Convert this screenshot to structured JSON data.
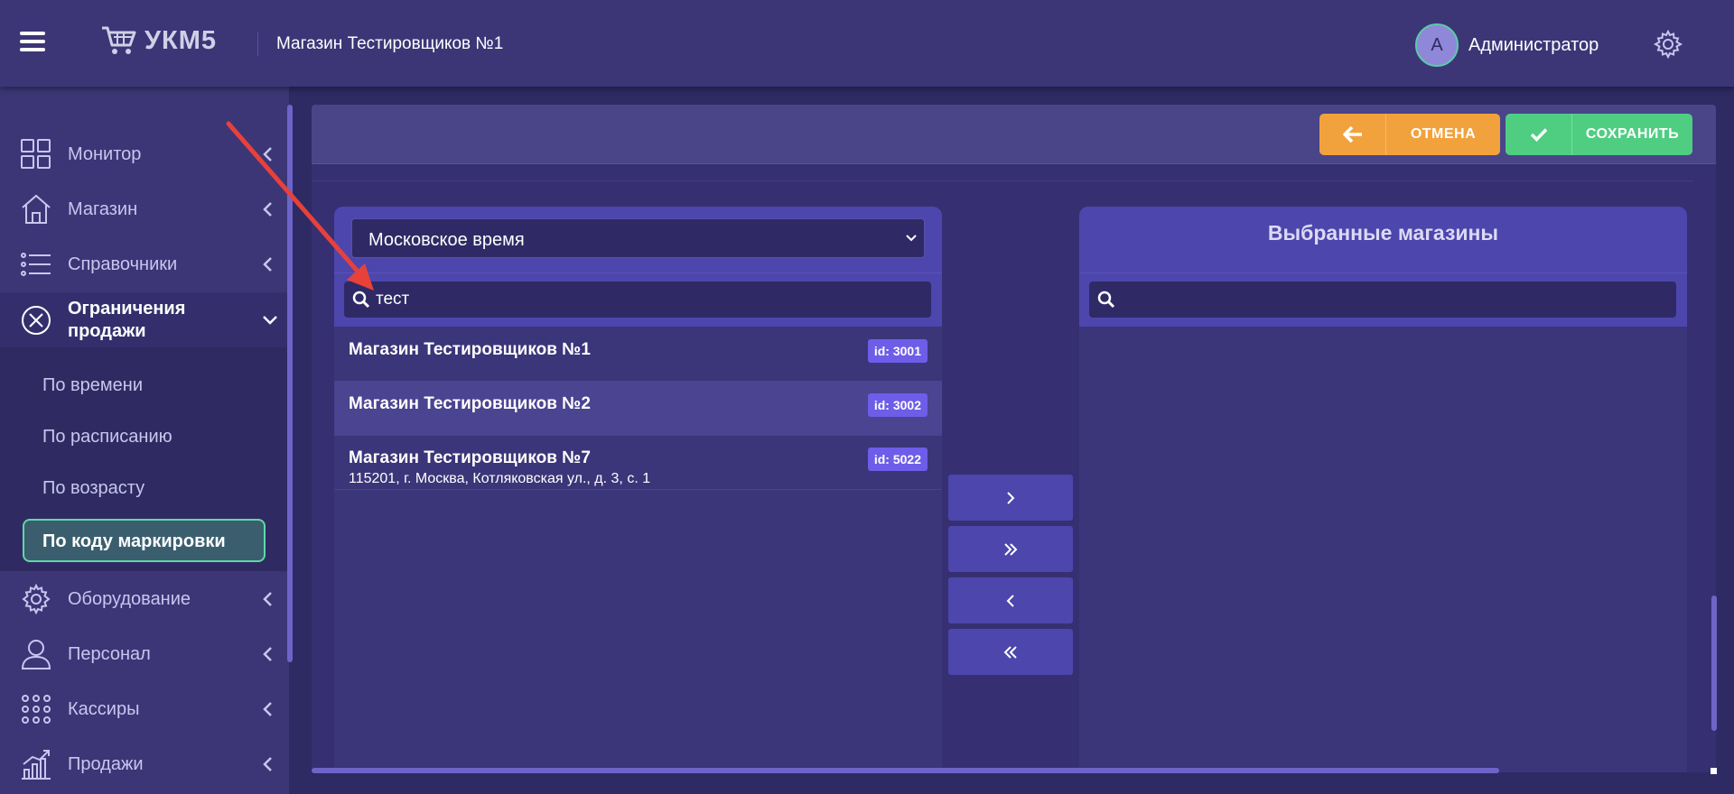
{
  "header": {
    "logo_text": "УКМ5",
    "store_title": "Магазин Тестировщиков №1",
    "avatar_letter": "A",
    "user_name": "Администратор"
  },
  "sidebar": {
    "items": [
      {
        "label": "Монитор",
        "icon": "monitor-grid-icon"
      },
      {
        "label": "Магазин",
        "icon": "store-house-icon"
      },
      {
        "label": "Справочники",
        "icon": "list-icon"
      },
      {
        "label": "Ограничения продажи",
        "icon": "restriction-x-icon"
      },
      {
        "label": "Оборудование",
        "icon": "gear-icon"
      },
      {
        "label": "Персонал",
        "icon": "person-icon"
      },
      {
        "label": "Кассиры",
        "icon": "dots-grid-icon"
      },
      {
        "label": "Продажи",
        "icon": "sales-chart-icon"
      }
    ],
    "submenu": [
      {
        "label": "По времени"
      },
      {
        "label": "По расписанию"
      },
      {
        "label": "По возрасту"
      },
      {
        "label": "По коду маркировки",
        "active": true
      }
    ]
  },
  "toolbar": {
    "cancel_label": "ОТМЕНА",
    "save_label": "СОХРАНИТЬ"
  },
  "left_list": {
    "timezone_selected": "Московское время",
    "search_value": "тест",
    "items": [
      {
        "title": "Магазин Тестировщиков №1",
        "id": "id: 3001",
        "address": ""
      },
      {
        "title": "Магазин Тестировщиков №2",
        "id": "id: 3002",
        "address": ""
      },
      {
        "title": "Магазин Тестировщиков №7",
        "id": "id: 5022",
        "address": "115201, г. Москва, Котляковская ул., д. 3, с. 1"
      }
    ]
  },
  "right_list": {
    "title": "Выбранные магазины",
    "search_value": ""
  },
  "colors": {
    "background": "#2e2a63",
    "header": "#3c3677",
    "accent_purple": "#4d46ad",
    "badge": "#6e5de8",
    "cancel": "#f2a23c",
    "save": "#4fce82",
    "active_border": "#5ed8a6",
    "annotation_arrow": "#e8413a"
  }
}
